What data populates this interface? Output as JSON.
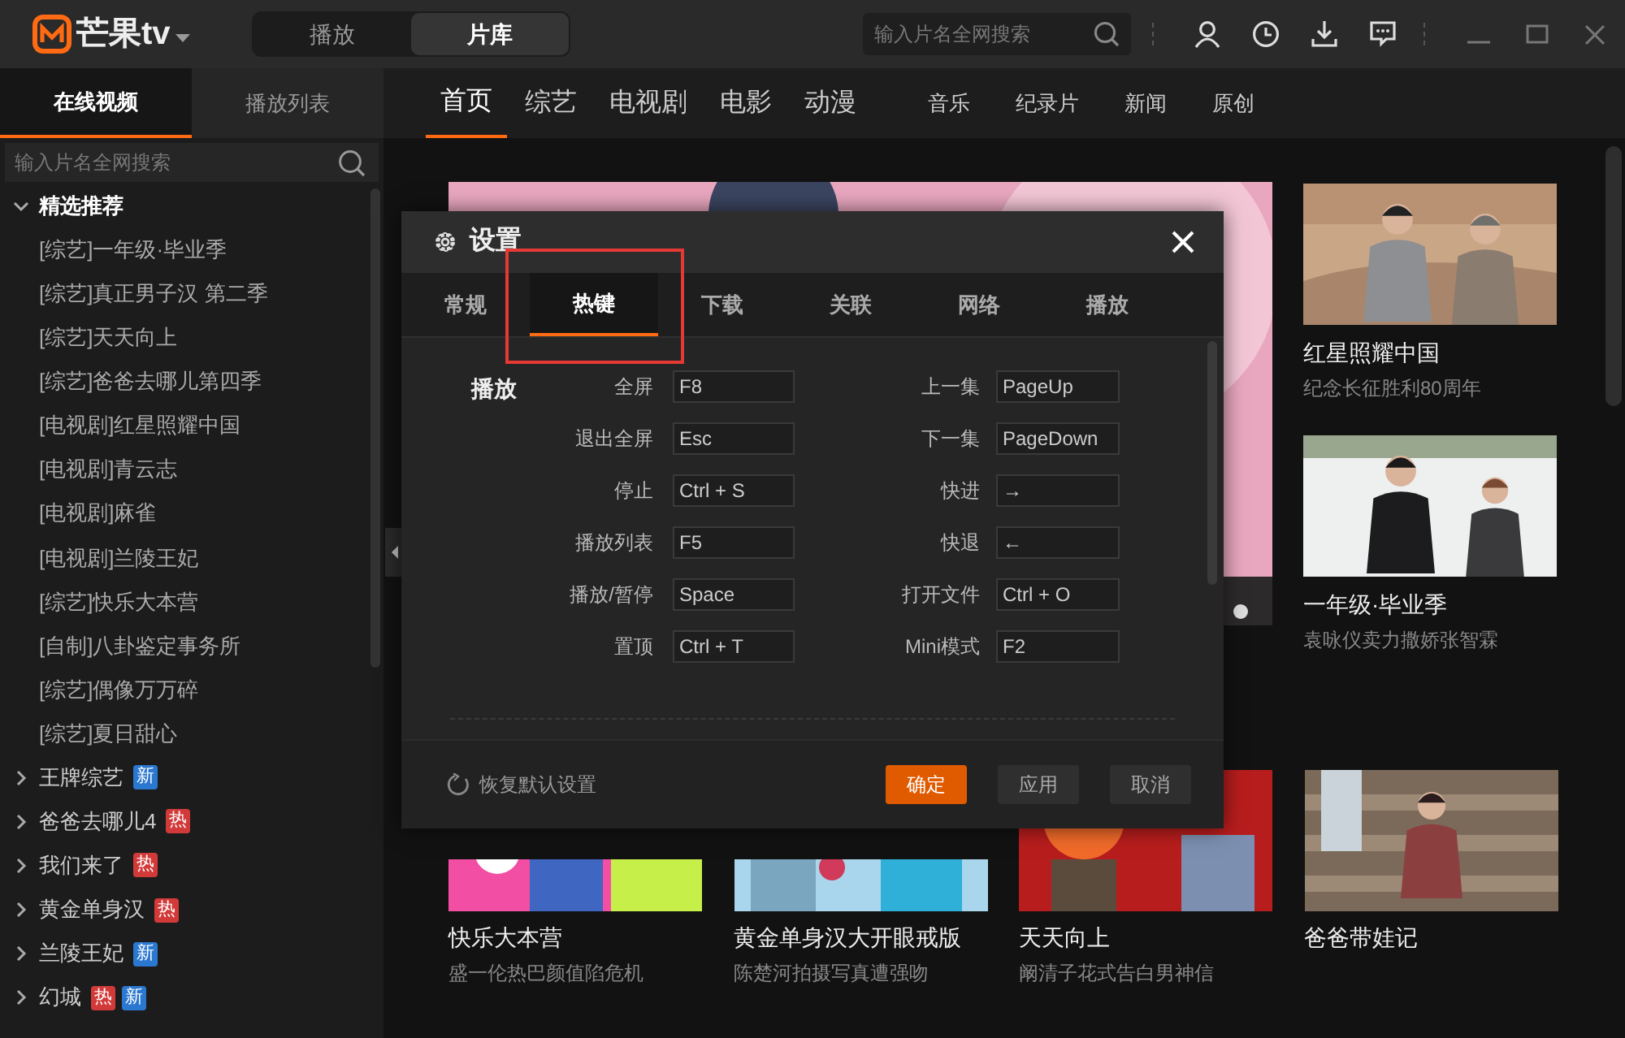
{
  "app": {
    "logo": "芒果tv"
  },
  "mode_tabs": [
    {
      "label": "播放",
      "selected": false
    },
    {
      "label": "片库",
      "selected": true
    }
  ],
  "top_search": {
    "placeholder": "输入片名全网搜索"
  },
  "sidebar": {
    "tabs": [
      {
        "label": "在线视频",
        "selected": true
      },
      {
        "label": "播放列表",
        "selected": false
      }
    ],
    "search": {
      "placeholder": "输入片名全网搜索"
    },
    "tree": [
      {
        "label": "精选推荐",
        "expanded": true,
        "children": [
          {
            "label": "[综艺]一年级·毕业季"
          },
          {
            "label": "[综艺]真正男子汉 第二季"
          },
          {
            "label": "[综艺]天天向上"
          },
          {
            "label": "[综艺]爸爸去哪儿第四季"
          },
          {
            "label": "[电视剧]红星照耀中国"
          },
          {
            "label": "[电视剧]青云志"
          },
          {
            "label": "[电视剧]麻雀"
          },
          {
            "label": "[电视剧]兰陵王妃"
          },
          {
            "label": "[综艺]快乐大本营"
          },
          {
            "label": "[自制]八卦鉴定事务所"
          },
          {
            "label": "[综艺]偶像万万碎"
          },
          {
            "label": "[综艺]夏日甜心"
          }
        ]
      },
      {
        "label": "王牌综艺",
        "expanded": false,
        "badges": [
          {
            "text": "新",
            "color": "#2b78d0"
          }
        ]
      },
      {
        "label": "爸爸去哪儿4",
        "expanded": false,
        "badges": [
          {
            "text": "热",
            "color": "#d23a3a"
          }
        ]
      },
      {
        "label": "我们来了",
        "expanded": false,
        "badges": [
          {
            "text": "热",
            "color": "#d23a3a"
          }
        ]
      },
      {
        "label": "黄金单身汉",
        "expanded": false,
        "badges": [
          {
            "text": "热",
            "color": "#d23a3a"
          }
        ]
      },
      {
        "label": "兰陵王妃",
        "expanded": false,
        "badges": [
          {
            "text": "新",
            "color": "#2b78d0"
          }
        ]
      },
      {
        "label": "幻城",
        "expanded": false,
        "badges": [
          {
            "text": "热",
            "color": "#d23a3a"
          },
          {
            "text": "新",
            "color": "#2b78d0"
          }
        ]
      }
    ]
  },
  "nav": [
    {
      "label": "首页",
      "kind": "major",
      "selected": true
    },
    {
      "label": "综艺",
      "kind": "major",
      "selected": false
    },
    {
      "label": "电视剧",
      "kind": "major",
      "selected": false
    },
    {
      "label": "电影",
      "kind": "major",
      "selected": false
    },
    {
      "label": "动漫",
      "kind": "major",
      "selected": false
    },
    {
      "label": "音乐",
      "kind": "minor",
      "selected": false
    },
    {
      "label": "纪录片",
      "kind": "minor",
      "selected": false
    },
    {
      "label": "新闻",
      "kind": "minor",
      "selected": false
    },
    {
      "label": "原创",
      "kind": "minor",
      "selected": false
    }
  ],
  "side_cards": [
    {
      "title": "红星照耀中国",
      "subtitle": "纪念长征胜利80周年"
    },
    {
      "title": "一年级·毕业季",
      "subtitle": "袁咏仪卖力撒娇张智霖"
    }
  ],
  "bottom_cards": [
    {
      "title": "快乐大本营",
      "subtitle": "盛一伦热巴颜值陷危机"
    },
    {
      "title": "黄金单身汉大开眼戒版",
      "subtitle": "陈楚河拍摄写真遭强吻"
    },
    {
      "title": "天天向上",
      "subtitle": "阚清子花式告白男神信"
    },
    {
      "title": "爸爸带娃记"
    }
  ],
  "dialog": {
    "title": "设置",
    "tabs": [
      {
        "label": "常规",
        "selected": false,
        "highlighted": false
      },
      {
        "label": "热键",
        "selected": true,
        "highlighted": true
      },
      {
        "label": "下载",
        "selected": false,
        "highlighted": false
      },
      {
        "label": "关联",
        "selected": false,
        "highlighted": false
      },
      {
        "label": "网络",
        "selected": false,
        "highlighted": false
      },
      {
        "label": "播放",
        "selected": false,
        "highlighted": false
      }
    ],
    "sections": [
      {
        "title": "播放",
        "rows": [
          {
            "left": {
              "label": "全屏",
              "value": "F8"
            },
            "right": {
              "label": "上一集",
              "value": "PageUp"
            }
          },
          {
            "left": {
              "label": "退出全屏",
              "value": "Esc"
            },
            "right": {
              "label": "下一集",
              "value": "PageDown"
            }
          },
          {
            "left": {
              "label": "停止",
              "value": "Ctrl + S"
            },
            "right": {
              "label": "快进",
              "value": "→"
            }
          },
          {
            "left": {
              "label": "播放列表",
              "value": "F5"
            },
            "right": {
              "label": "快退",
              "value": "←"
            }
          },
          {
            "left": {
              "label": "播放/暂停",
              "value": "Space"
            },
            "right": {
              "label": "打开文件",
              "value": "Ctrl + O"
            }
          },
          {
            "left": {
              "label": "置顶",
              "value": "Ctrl + T"
            },
            "right": {
              "label": "Mini模式",
              "value": "F2"
            }
          }
        ]
      }
    ],
    "reset": "恢复默认设置",
    "buttons": [
      {
        "label": "确定",
        "kind": "primary"
      },
      {
        "label": "应用",
        "kind": "secondary"
      },
      {
        "label": "取消",
        "kind": "secondary"
      }
    ]
  }
}
